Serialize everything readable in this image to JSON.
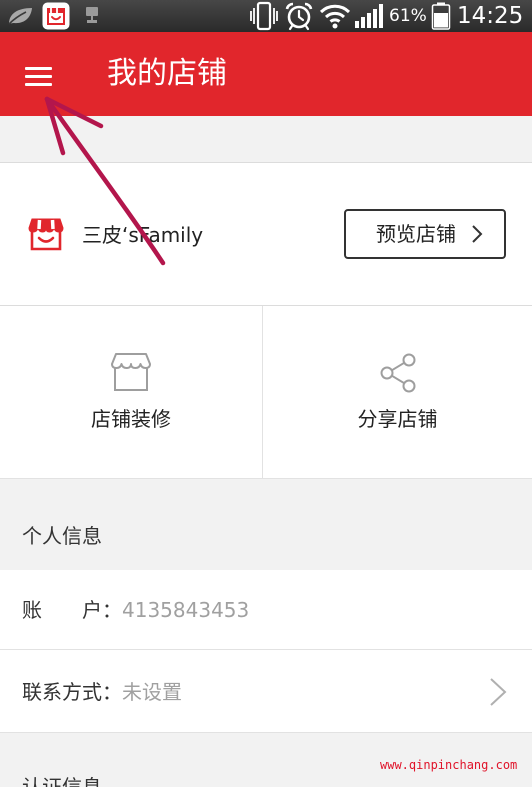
{
  "colors": {
    "brand_red": "#e1262c",
    "status_bar_bg": "#333333",
    "page_bg": "#f2f2f2",
    "text_primary": "#222222",
    "text_secondary": "#a0a0a0",
    "watermark": "#e0142a",
    "annotation_arrow": "#b3164c"
  },
  "status_bar": {
    "icons_left": [
      "leaf-icon",
      "app-store-icon",
      "usb-debug-icon"
    ],
    "icons_right": [
      "vibrate-icon",
      "alarm-icon",
      "wifi-icon",
      "signal-icon",
      "battery-icon"
    ],
    "battery": "61%",
    "time": "14:25"
  },
  "header": {
    "menu_icon": "hamburger-menu-icon",
    "title": "我的店铺"
  },
  "store": {
    "logo_icon": "store-logo-icon",
    "name": "三皮‘sFamily",
    "preview_button": {
      "label": "预览店铺",
      "icon": "chevron-right-icon"
    }
  },
  "actions": [
    {
      "label": "店铺装修",
      "icon": "storefront-icon"
    },
    {
      "label": "分享店铺",
      "icon": "share-icon"
    }
  ],
  "personal_info": {
    "title": "个人信息",
    "account": {
      "label": "账　　户：",
      "value": "4135843453"
    },
    "contact": {
      "label": "联系方式：",
      "value": "未设置",
      "icon": "chevron-right-icon"
    }
  },
  "certification": {
    "title": "认证信息"
  },
  "watermark": "www.qinpinchang.com",
  "annotation": {
    "icon": "hand-drawn-arrow-icon"
  }
}
